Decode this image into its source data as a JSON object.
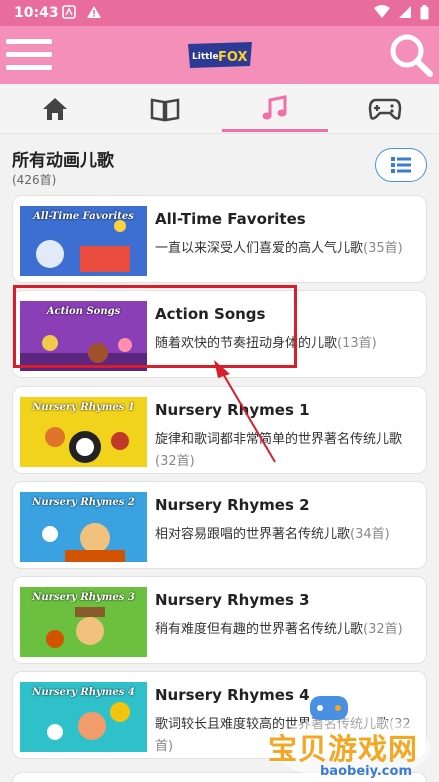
{
  "status": {
    "time": "10:43"
  },
  "app": {
    "logo_text": "Little FOX"
  },
  "tabs": [
    {
      "icon": "home-icon",
      "active": false
    },
    {
      "icon": "book-icon",
      "active": false
    },
    {
      "icon": "music-note-icon",
      "active": true
    },
    {
      "icon": "gamepad-icon",
      "active": false
    }
  ],
  "section": {
    "title": "所有动画儿歌",
    "count": "(426首)"
  },
  "cards": [
    {
      "title": "All-Time Favorites",
      "desc": "一直以来深受人们喜爱的高人气儿歌",
      "num": "(35首)",
      "thumb_label": "All-Time Favorites",
      "thumb_color": "#3c6fd1"
    },
    {
      "title": "Action Songs",
      "desc": "随着欢快的节奏扭动身体的儿歌",
      "num": "(13首)",
      "thumb_label": "Action Songs",
      "thumb_color": "#8a3fb6"
    },
    {
      "title": "Nursery Rhymes 1",
      "desc": "旋律和歌词都非常简单的世界著名传统儿歌",
      "num": "(32首)",
      "thumb_label": "Nursery Rhymes 1",
      "thumb_color": "#f2d31c"
    },
    {
      "title": "Nursery Rhymes 2",
      "desc": "相对容易跟唱的世界著名传统儿歌",
      "num": "(34首)",
      "thumb_label": "Nursery Rhymes 2",
      "thumb_color": "#3aa2e0"
    },
    {
      "title": "Nursery Rhymes 3",
      "desc": "稍有难度但有趣的世界著名传统儿歌",
      "num": "(32首)",
      "thumb_label": "Nursery Rhymes 3",
      "thumb_color": "#6cc040"
    },
    {
      "title": "Nursery Rhymes 4",
      "desc": "歌词较长且难度较高的世界著名传统儿歌",
      "num": "(32首)",
      "thumb_label": "Nursery Rhymes 4",
      "thumb_color": "#2fc1c9"
    }
  ],
  "watermark": {
    "text": "宝贝游戏网",
    "url": "baobeiy.com"
  },
  "colors": {
    "accent": "#f48fba",
    "statusbar": "#e96d9c",
    "tab_active": "#f06fa7",
    "highlight": "#d81e2a"
  }
}
